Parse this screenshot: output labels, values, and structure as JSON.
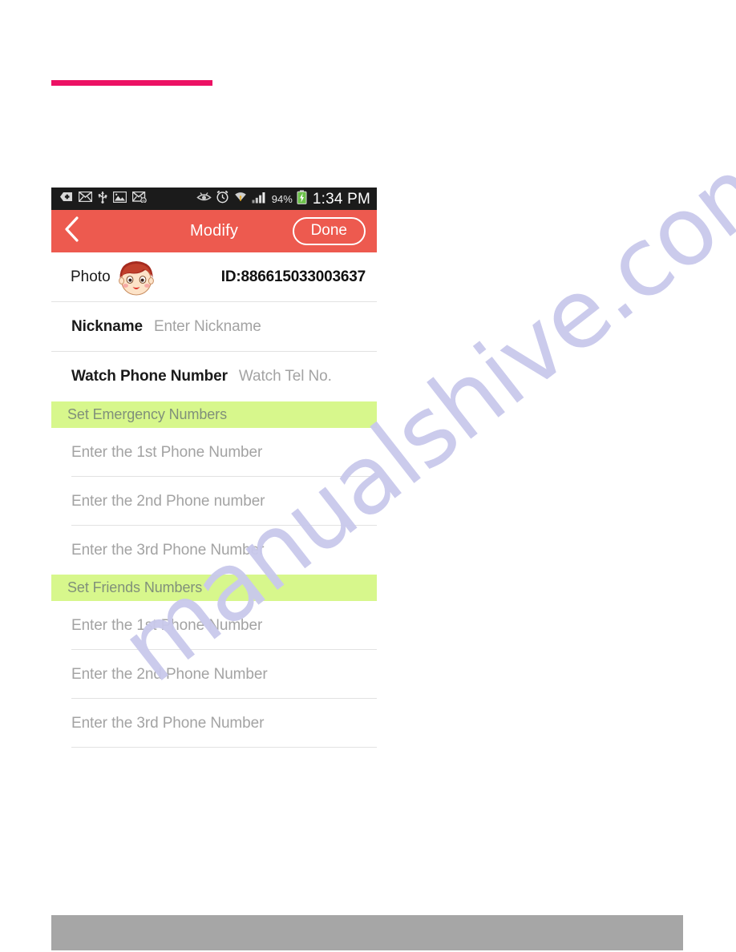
{
  "page": {
    "accent_pink": "#ec1164",
    "footer_gray": "#a6a6a6",
    "watermark_text": "manualshive.com"
  },
  "phone": {
    "status_bar": {
      "background": "#1b1b1b",
      "left_icons": [
        "download-tag-icon",
        "envelope-icon",
        "usb-icon",
        "gallery-image-icon",
        "email-attachment-icon"
      ],
      "right_icons": [
        "eye-smart-stay-icon",
        "alarm-clock-icon",
        "wifi-icon",
        "signal-bars-icon"
      ],
      "battery_percent": "94%",
      "battery_icon": "battery-charging-icon",
      "clock": "1:34 PM"
    },
    "header": {
      "background": "#ed5a4f",
      "back_icon": "chevron-left-icon",
      "title": "Modify",
      "done_label": "Done"
    },
    "photo_row": {
      "label": "Photo",
      "avatar_icon": "boy-avatar-icon",
      "watch_id": "ID:886615033003637"
    },
    "fields": [
      {
        "label": "Nickname",
        "placeholder": "Enter Nickname"
      },
      {
        "label": "Watch Phone Number",
        "placeholder": "Watch Tel No."
      }
    ],
    "sections": [
      {
        "header": "Set Emergency Numbers",
        "header_background": "#d7f78c",
        "rows": [
          {
            "placeholder": "Enter the 1st Phone Number"
          },
          {
            "placeholder": "Enter the 2nd Phone number"
          },
          {
            "placeholder": "Enter the 3rd Phone Number"
          }
        ]
      },
      {
        "header": "Set Friends Numbers",
        "header_background": "#d7f78c",
        "rows": [
          {
            "placeholder": "Enter the 1st Phone Number"
          },
          {
            "placeholder": "Enter the 2nd Phone Number"
          },
          {
            "placeholder": "Enter the 3rd Phone Number"
          }
        ]
      }
    ]
  }
}
